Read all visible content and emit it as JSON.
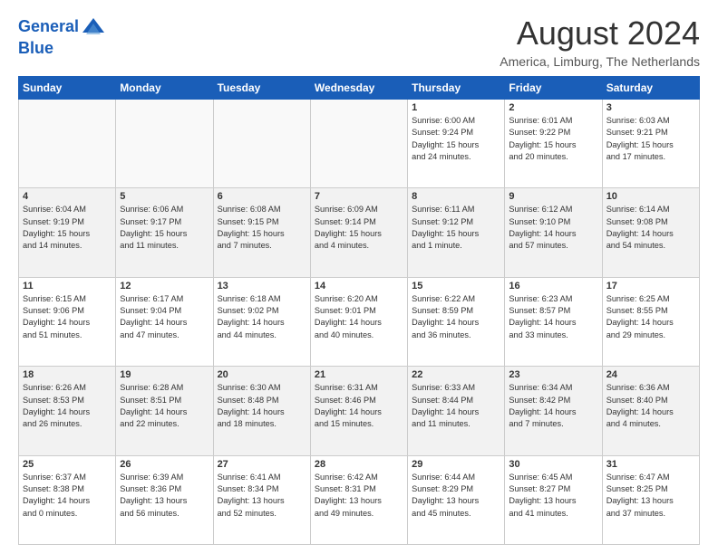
{
  "header": {
    "logo_line1": "General",
    "logo_line2": "Blue",
    "month_year": "August 2024",
    "location": "America, Limburg, The Netherlands"
  },
  "days_of_week": [
    "Sunday",
    "Monday",
    "Tuesday",
    "Wednesday",
    "Thursday",
    "Friday",
    "Saturday"
  ],
  "rows": [
    [
      {
        "day": "",
        "info": ""
      },
      {
        "day": "",
        "info": ""
      },
      {
        "day": "",
        "info": ""
      },
      {
        "day": "",
        "info": ""
      },
      {
        "day": "1",
        "info": "Sunrise: 6:00 AM\nSunset: 9:24 PM\nDaylight: 15 hours\nand 24 minutes."
      },
      {
        "day": "2",
        "info": "Sunrise: 6:01 AM\nSunset: 9:22 PM\nDaylight: 15 hours\nand 20 minutes."
      },
      {
        "day": "3",
        "info": "Sunrise: 6:03 AM\nSunset: 9:21 PM\nDaylight: 15 hours\nand 17 minutes."
      }
    ],
    [
      {
        "day": "4",
        "info": "Sunrise: 6:04 AM\nSunset: 9:19 PM\nDaylight: 15 hours\nand 14 minutes."
      },
      {
        "day": "5",
        "info": "Sunrise: 6:06 AM\nSunset: 9:17 PM\nDaylight: 15 hours\nand 11 minutes."
      },
      {
        "day": "6",
        "info": "Sunrise: 6:08 AM\nSunset: 9:15 PM\nDaylight: 15 hours\nand 7 minutes."
      },
      {
        "day": "7",
        "info": "Sunrise: 6:09 AM\nSunset: 9:14 PM\nDaylight: 15 hours\nand 4 minutes."
      },
      {
        "day": "8",
        "info": "Sunrise: 6:11 AM\nSunset: 9:12 PM\nDaylight: 15 hours\nand 1 minute."
      },
      {
        "day": "9",
        "info": "Sunrise: 6:12 AM\nSunset: 9:10 PM\nDaylight: 14 hours\nand 57 minutes."
      },
      {
        "day": "10",
        "info": "Sunrise: 6:14 AM\nSunset: 9:08 PM\nDaylight: 14 hours\nand 54 minutes."
      }
    ],
    [
      {
        "day": "11",
        "info": "Sunrise: 6:15 AM\nSunset: 9:06 PM\nDaylight: 14 hours\nand 51 minutes."
      },
      {
        "day": "12",
        "info": "Sunrise: 6:17 AM\nSunset: 9:04 PM\nDaylight: 14 hours\nand 47 minutes."
      },
      {
        "day": "13",
        "info": "Sunrise: 6:18 AM\nSunset: 9:02 PM\nDaylight: 14 hours\nand 44 minutes."
      },
      {
        "day": "14",
        "info": "Sunrise: 6:20 AM\nSunset: 9:01 PM\nDaylight: 14 hours\nand 40 minutes."
      },
      {
        "day": "15",
        "info": "Sunrise: 6:22 AM\nSunset: 8:59 PM\nDaylight: 14 hours\nand 36 minutes."
      },
      {
        "day": "16",
        "info": "Sunrise: 6:23 AM\nSunset: 8:57 PM\nDaylight: 14 hours\nand 33 minutes."
      },
      {
        "day": "17",
        "info": "Sunrise: 6:25 AM\nSunset: 8:55 PM\nDaylight: 14 hours\nand 29 minutes."
      }
    ],
    [
      {
        "day": "18",
        "info": "Sunrise: 6:26 AM\nSunset: 8:53 PM\nDaylight: 14 hours\nand 26 minutes."
      },
      {
        "day": "19",
        "info": "Sunrise: 6:28 AM\nSunset: 8:51 PM\nDaylight: 14 hours\nand 22 minutes."
      },
      {
        "day": "20",
        "info": "Sunrise: 6:30 AM\nSunset: 8:48 PM\nDaylight: 14 hours\nand 18 minutes."
      },
      {
        "day": "21",
        "info": "Sunrise: 6:31 AM\nSunset: 8:46 PM\nDaylight: 14 hours\nand 15 minutes."
      },
      {
        "day": "22",
        "info": "Sunrise: 6:33 AM\nSunset: 8:44 PM\nDaylight: 14 hours\nand 11 minutes."
      },
      {
        "day": "23",
        "info": "Sunrise: 6:34 AM\nSunset: 8:42 PM\nDaylight: 14 hours\nand 7 minutes."
      },
      {
        "day": "24",
        "info": "Sunrise: 6:36 AM\nSunset: 8:40 PM\nDaylight: 14 hours\nand 4 minutes."
      }
    ],
    [
      {
        "day": "25",
        "info": "Sunrise: 6:37 AM\nSunset: 8:38 PM\nDaylight: 14 hours\nand 0 minutes."
      },
      {
        "day": "26",
        "info": "Sunrise: 6:39 AM\nSunset: 8:36 PM\nDaylight: 13 hours\nand 56 minutes."
      },
      {
        "day": "27",
        "info": "Sunrise: 6:41 AM\nSunset: 8:34 PM\nDaylight: 13 hours\nand 52 minutes."
      },
      {
        "day": "28",
        "info": "Sunrise: 6:42 AM\nSunset: 8:31 PM\nDaylight: 13 hours\nand 49 minutes."
      },
      {
        "day": "29",
        "info": "Sunrise: 6:44 AM\nSunset: 8:29 PM\nDaylight: 13 hours\nand 45 minutes."
      },
      {
        "day": "30",
        "info": "Sunrise: 6:45 AM\nSunset: 8:27 PM\nDaylight: 13 hours\nand 41 minutes."
      },
      {
        "day": "31",
        "info": "Sunrise: 6:47 AM\nSunset: 8:25 PM\nDaylight: 13 hours\nand 37 minutes."
      }
    ]
  ]
}
